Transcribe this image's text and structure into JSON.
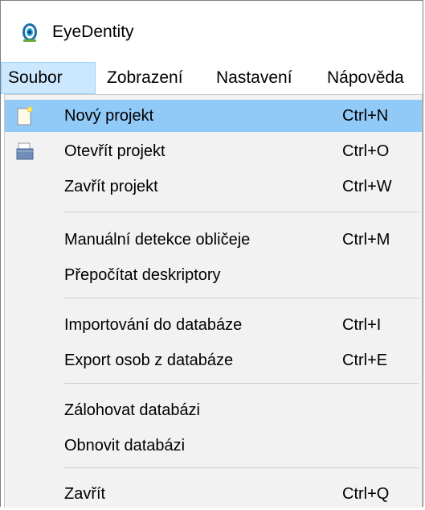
{
  "window": {
    "title": "EyeDentity"
  },
  "menubar": {
    "items": [
      {
        "label": "Soubor",
        "active": true
      },
      {
        "label": "Zobrazení",
        "active": false
      },
      {
        "label": "Nastavení",
        "active": false
      },
      {
        "label": "Nápověda",
        "active": false
      }
    ]
  },
  "dropdown": {
    "items": [
      {
        "label": "Nový projekt",
        "shortcut": "Ctrl+N",
        "icon": "new-document-icon",
        "highlighted": true
      },
      {
        "label": "Otevřít projekt",
        "shortcut": "Ctrl+O",
        "icon": "open-folder-icon",
        "highlighted": false
      },
      {
        "label": "Zavřít projekt",
        "shortcut": "Ctrl+W",
        "icon": "",
        "highlighted": false
      },
      {
        "label": "Manuální detekce obličeje",
        "shortcut": "Ctrl+M",
        "icon": "",
        "highlighted": false
      },
      {
        "label": "Přepočítat deskriptory",
        "shortcut": "",
        "icon": "",
        "highlighted": false
      },
      {
        "label": "Importování do databáze",
        "shortcut": "Ctrl+I",
        "icon": "",
        "highlighted": false
      },
      {
        "label": "Export osob z databáze",
        "shortcut": "Ctrl+E",
        "icon": "",
        "highlighted": false
      },
      {
        "label": "Zálohovat databázi",
        "shortcut": "",
        "icon": "",
        "highlighted": false
      },
      {
        "label": "Obnovit databázi",
        "shortcut": "",
        "icon": "",
        "highlighted": false
      },
      {
        "label": "Zavřít",
        "shortcut": "Ctrl+Q",
        "icon": "",
        "highlighted": false
      }
    ]
  },
  "colors": {
    "highlight": "#91c9f7",
    "menubar_active": "#cce8ff",
    "dropdown_bg": "#f2f2f2"
  }
}
